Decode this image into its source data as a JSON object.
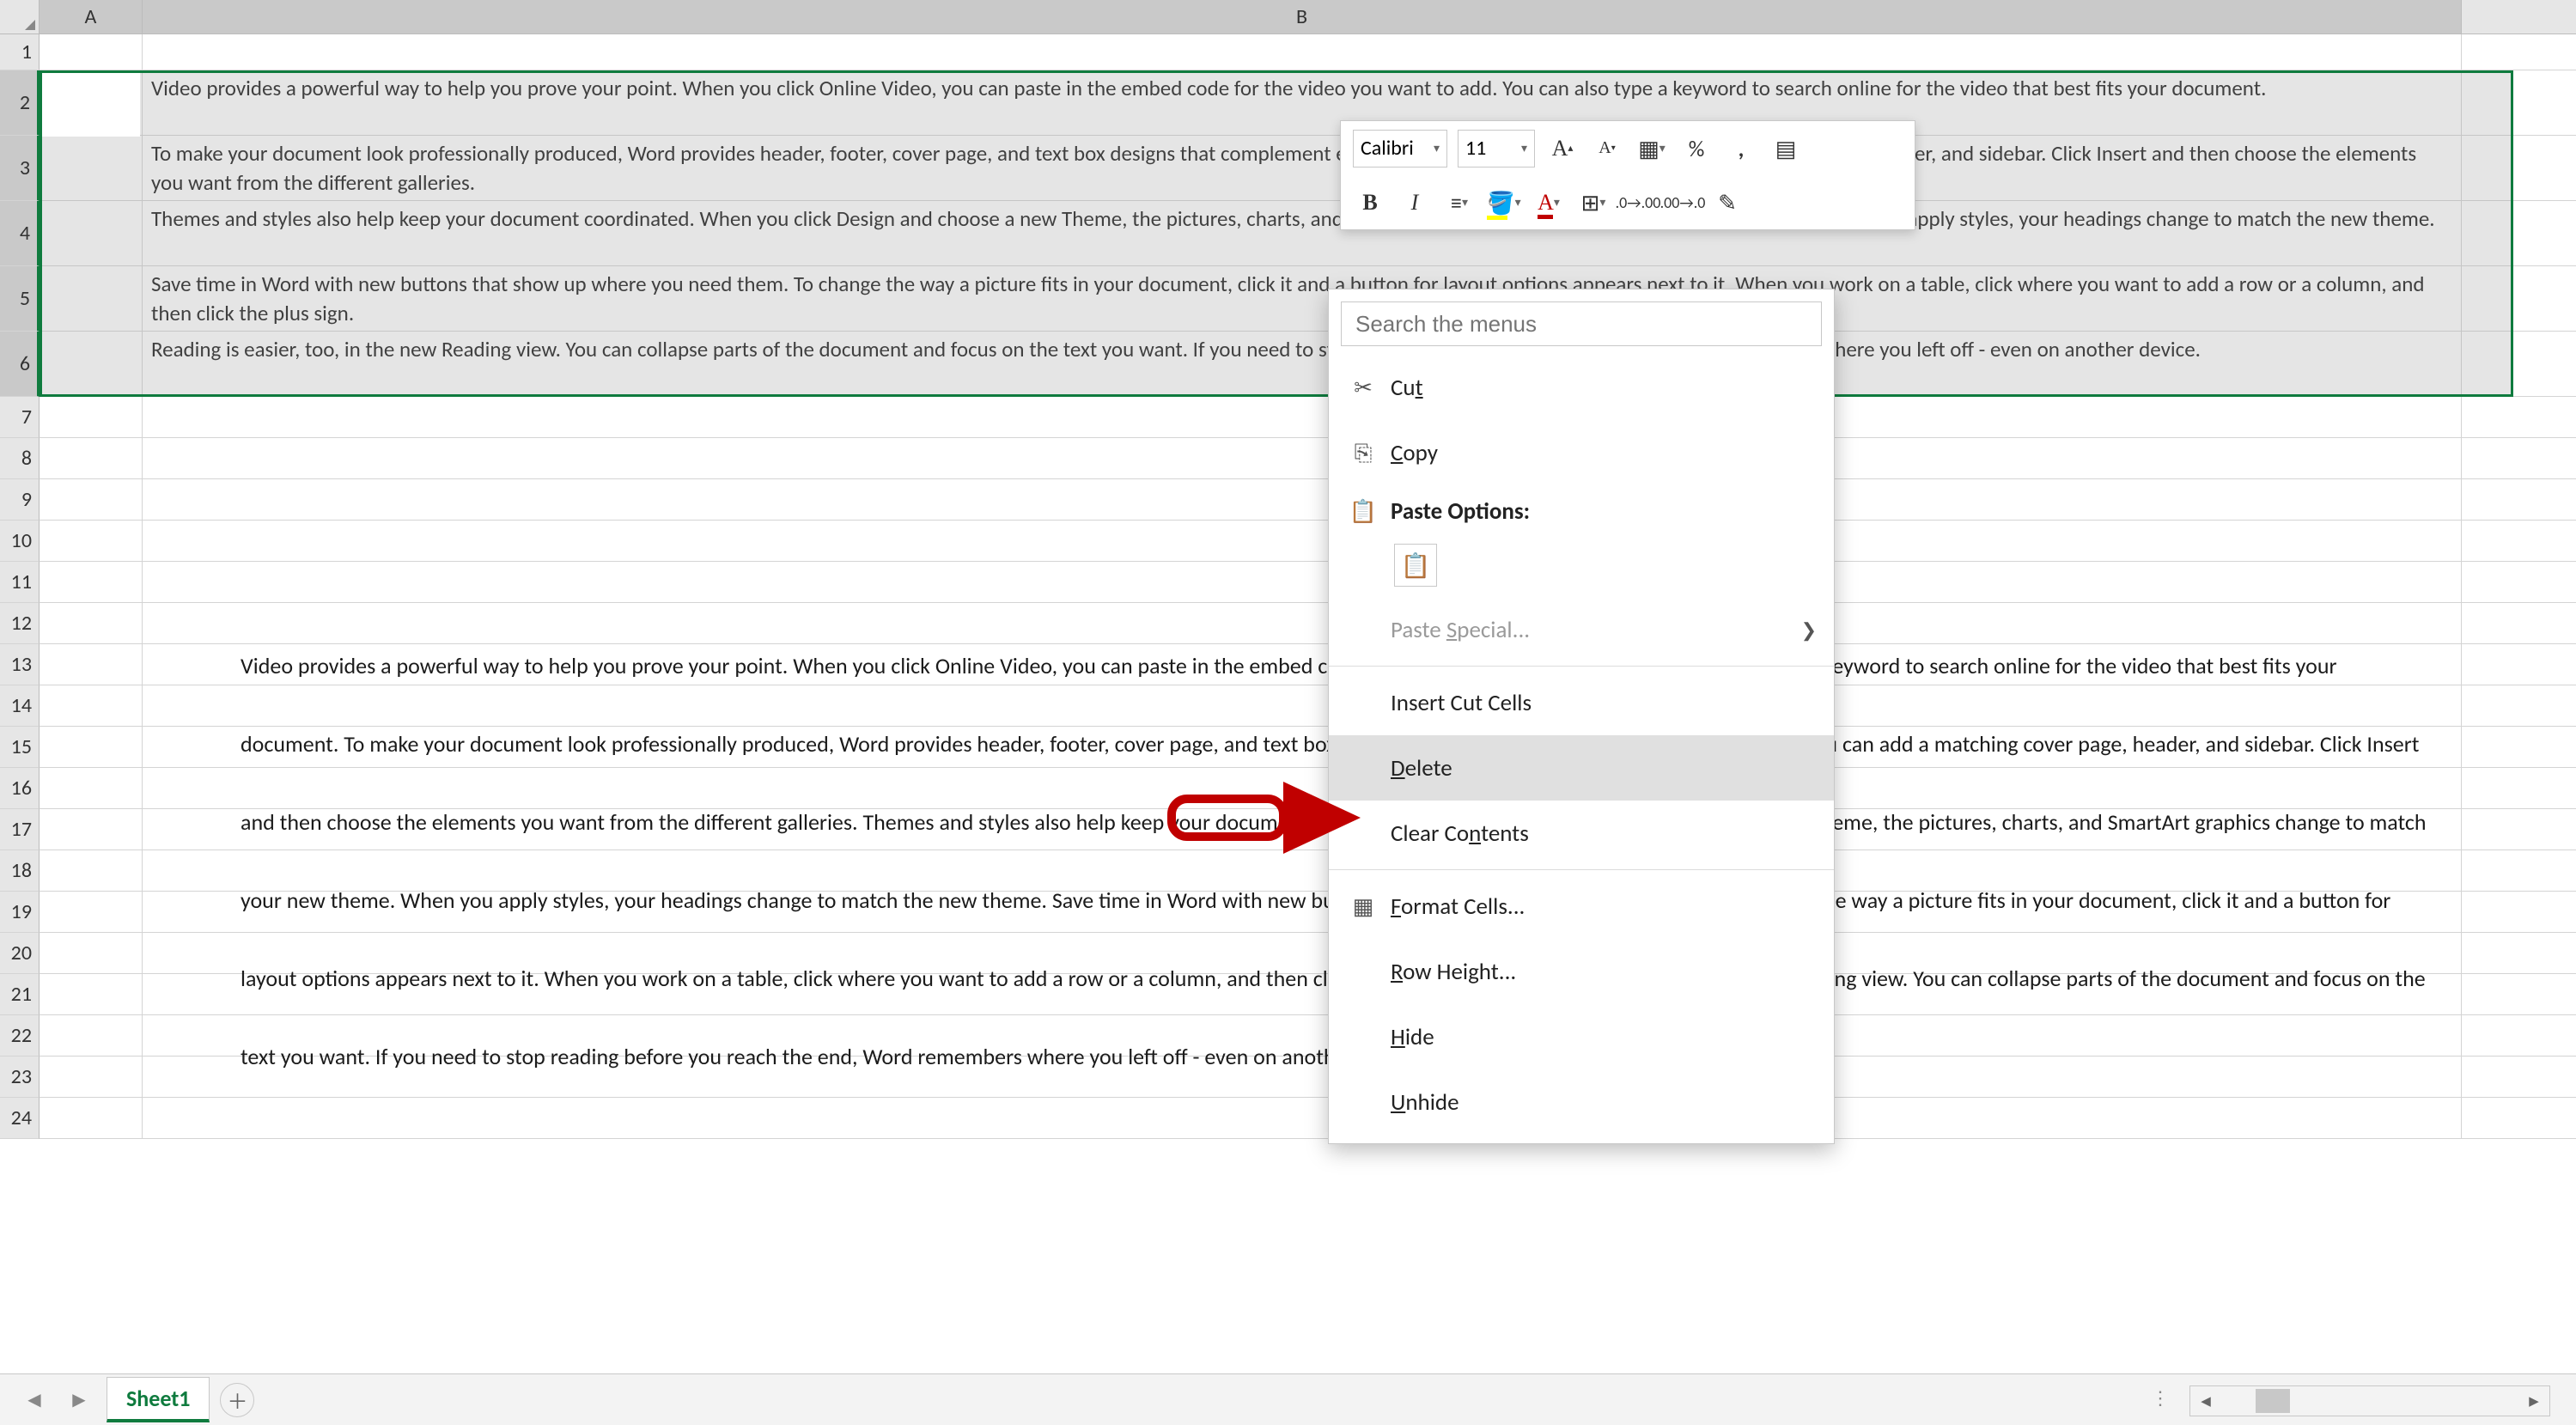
{
  "columns": [
    "A",
    "B"
  ],
  "rows": [
    {
      "n": 1,
      "h": 42,
      "sel": false,
      "b": ""
    },
    {
      "n": 2,
      "h": 76,
      "sel": true,
      "b": "Video provides a powerful way to help you prove your point. When you click Online Video, you can paste in the embed code for the video you want to add. You can also type a keyword to search online for the video that best fits your document."
    },
    {
      "n": 3,
      "h": 76,
      "sel": true,
      "b": "To make your document look professionally produced, Word provides header, footer, cover page, and text box designs that complement each other. For example, you can add a matching cover page, header, and sidebar. Click Insert and then choose the elements you want from the different galleries."
    },
    {
      "n": 4,
      "h": 76,
      "sel": true,
      "b": "Themes and styles also help keep your document coordinated. When you click Design and choose a new Theme, the pictures, charts, and SmartArt graphics change to match your new theme. When you apply styles, your headings change to match the new theme."
    },
    {
      "n": 5,
      "h": 76,
      "sel": true,
      "b": "Save time in Word with new buttons that show up where you need them. To change the way a picture fits in your document, click it and a button for layout options appears next to it. When you work on a table, click where you want to add a row or a column, and then click the plus sign."
    },
    {
      "n": 6,
      "h": 76,
      "sel": true,
      "b": "Reading is easier, too, in the new Reading view. You can collapse parts of the document and focus on the text you want. If you need to stop reading before you reach the end, Word remembers where you left off - even on another device."
    },
    {
      "n": 7,
      "h": 48,
      "sel": false,
      "b": ""
    },
    {
      "n": 8,
      "h": 48,
      "sel": false,
      "b": ""
    },
    {
      "n": 9,
      "h": 48,
      "sel": false,
      "b": ""
    },
    {
      "n": 10,
      "h": 48,
      "sel": false,
      "b": ""
    },
    {
      "n": 11,
      "h": 48,
      "sel": false,
      "b": ""
    },
    {
      "n": 12,
      "h": 48,
      "sel": false,
      "b": ""
    },
    {
      "n": 13,
      "h": 48,
      "sel": false,
      "b": ""
    },
    {
      "n": 14,
      "h": 48,
      "sel": false,
      "b": ""
    },
    {
      "n": 15,
      "h": 48,
      "sel": false,
      "b": ""
    },
    {
      "n": 16,
      "h": 48,
      "sel": false,
      "b": ""
    },
    {
      "n": 17,
      "h": 48,
      "sel": false,
      "b": ""
    },
    {
      "n": 18,
      "h": 48,
      "sel": false,
      "b": ""
    },
    {
      "n": 19,
      "h": 48,
      "sel": false,
      "b": ""
    },
    {
      "n": 20,
      "h": 48,
      "sel": false,
      "b": ""
    },
    {
      "n": 21,
      "h": 48,
      "sel": false,
      "b": ""
    },
    {
      "n": 22,
      "h": 48,
      "sel": false,
      "b": ""
    },
    {
      "n": 23,
      "h": 48,
      "sel": false,
      "b": ""
    },
    {
      "n": 24,
      "h": 48,
      "sel": false,
      "b": ""
    }
  ],
  "paragraph_block": "Video provides a powerful way to help you prove your point. When you click Online Video, you can paste in the embed code for the video you want to add. You can also type a keyword to search online for the video that best fits your document. To make your document look professionally produced, Word provides header, footer, cover page, and text box designs that complement each other. For example, you can add a matching cover page, header, and sidebar. Click Insert and then choose the elements you want from the different galleries. Themes and styles also help keep your document coordinated. When you click Design and choose a new Theme, the pictures, charts, and SmartArt graphics change to match your new theme. When you apply styles, your headings change to match the new theme. Save time in Word with new buttons that show up where you need them. To change the way a picture fits in your document, click it and a button for layout options appears next to it. When you work on a table, click where you want to add a row or a column, and then click the plus sign. Reading is easier, too, in the new Reading view. You can collapse parts of the document and focus on the text you want. If you need to stop reading before you reach the end, Word remembers where you left off - even on another device.",
  "mini_toolbar": {
    "font": "Calibri",
    "size": "11",
    "increase_font": "A",
    "decrease_font": "A",
    "bold": "B",
    "italic": "I"
  },
  "context_menu": {
    "search_placeholder": "Search the menus",
    "cut": "Cut",
    "copy": "Copy",
    "paste_options": "Paste Options:",
    "paste_special": "Paste Special...",
    "insert_cut": "Insert Cut Cells",
    "delete": "Delete",
    "clear": "Clear Contents",
    "format_cells": "Format Cells...",
    "row_height": "Row Height...",
    "hide": "Hide",
    "unhide": "Unhide"
  },
  "tabs": {
    "sheet1": "Sheet1"
  }
}
